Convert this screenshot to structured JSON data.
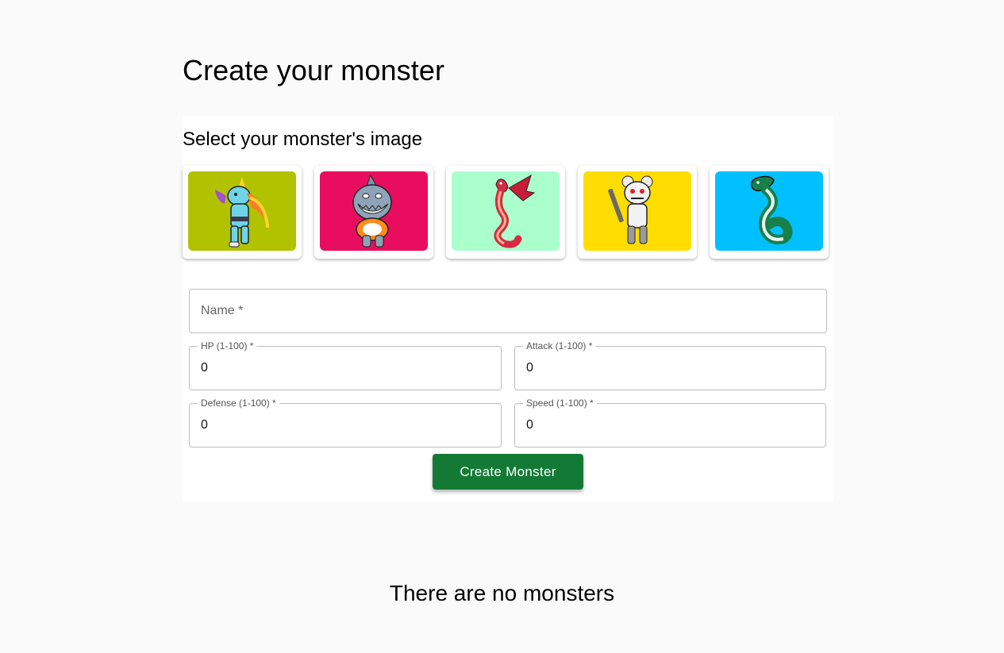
{
  "page": {
    "title": "Create your monster",
    "empty_message": "There are no monsters"
  },
  "image_picker": {
    "title": "Select your monster's image",
    "options": [
      {
        "name": "unicorn-monster",
        "bg": "#b1c200"
      },
      {
        "name": "shark-monster",
        "bg": "#e80d5f"
      },
      {
        "name": "dragon-monster",
        "bg": "#aaffcd"
      },
      {
        "name": "robot-bear-monster",
        "bg": "#ffdd00"
      },
      {
        "name": "snake-monster",
        "bg": "#00c0ff"
      }
    ]
  },
  "form": {
    "name": {
      "placeholder": "Name *",
      "value": ""
    },
    "hp": {
      "label": "HP (1-100) *",
      "value": "0"
    },
    "attack": {
      "label": "Attack (1-100) *",
      "value": "0"
    },
    "defense": {
      "label": "Defense (1-100) *",
      "value": "0"
    },
    "speed": {
      "label": "Speed (1-100) *",
      "value": "0"
    },
    "submit_label": "Create Monster"
  },
  "colors": {
    "page_bg": "#fafafa",
    "button_bg": "#137a35"
  }
}
